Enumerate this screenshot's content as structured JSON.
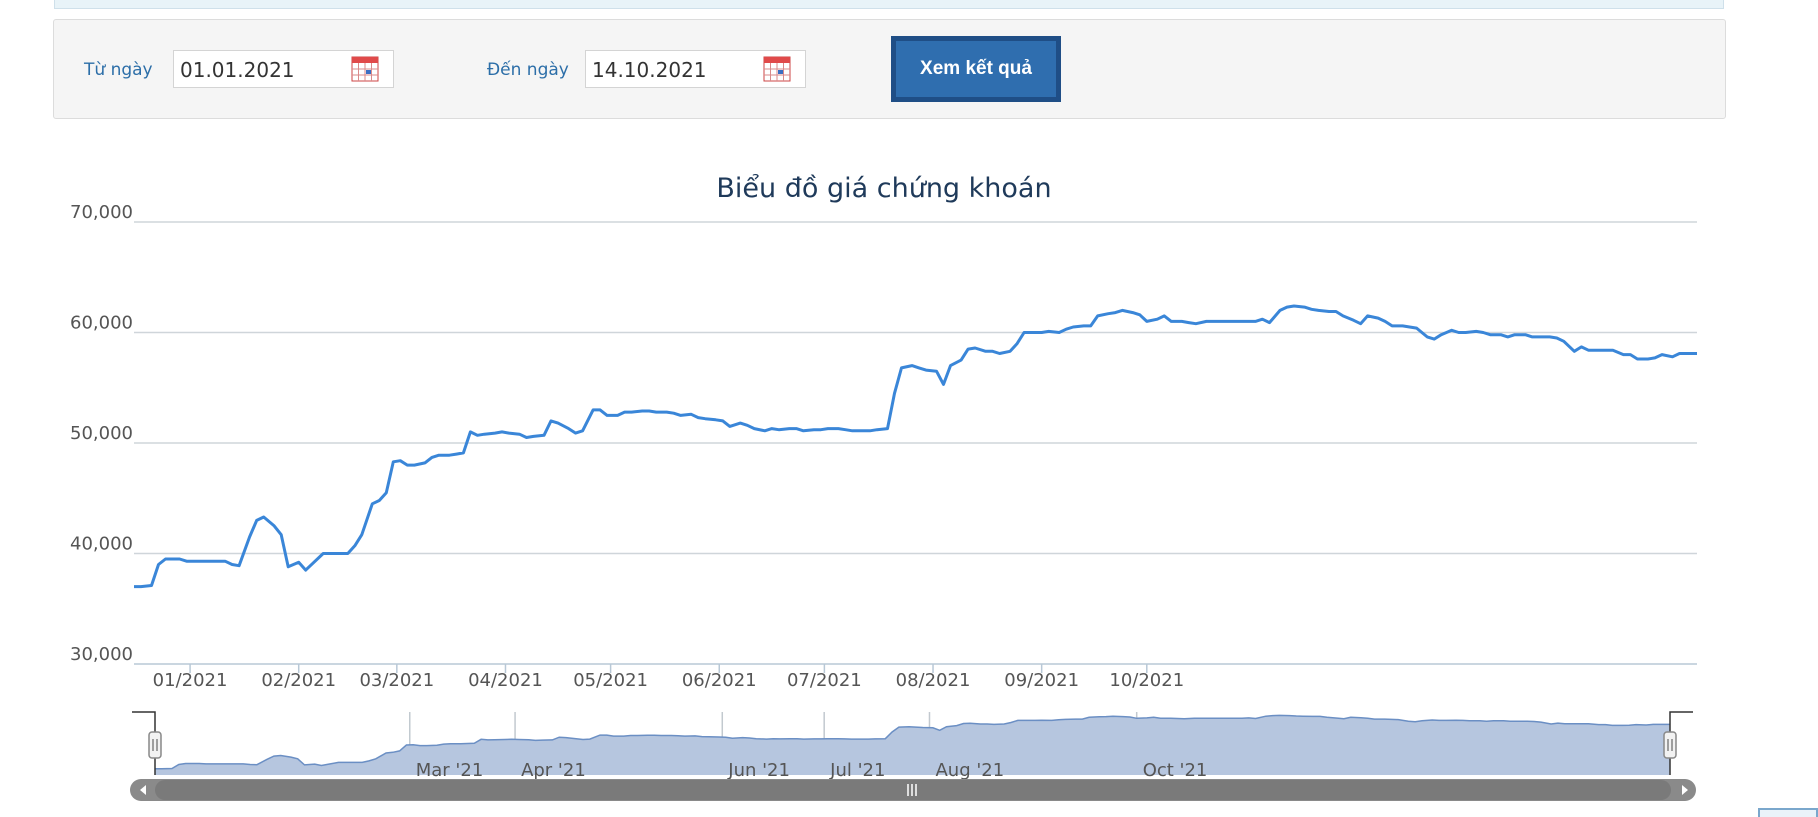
{
  "filter": {
    "from_label": "Từ ngày",
    "from_value": "01.01.2021",
    "to_label": "Đến ngày",
    "to_value": "14.10.2021",
    "submit_label": "Xem kết quả"
  },
  "colors": {
    "line": "#3a86d8",
    "navigator_fill": "#b6c6df",
    "navigator_line": "#6b8fc4",
    "grid": "#cfd5da",
    "button": "#2f6eaf"
  },
  "chart_data": {
    "type": "line",
    "title": "Biểu đồ giá chứng khoán",
    "xlabel": "",
    "ylabel": "",
    "ylim": [
      30000,
      70000
    ],
    "y_ticks": [
      "70,000",
      "60,000",
      "50,000",
      "40,000",
      "30,000"
    ],
    "y_tick_values": [
      70000,
      60000,
      50000,
      40000,
      30000
    ],
    "x_ticks": [
      {
        "label": "01/2021",
        "date": "2021-01-01"
      },
      {
        "label": "02/2021",
        "date": "2021-02-01"
      },
      {
        "label": "03/2021",
        "date": "2021-03-01"
      },
      {
        "label": "04/2021",
        "date": "2021-04-01"
      },
      {
        "label": "05/2021",
        "date": "2021-05-01"
      },
      {
        "label": "06/2021",
        "date": "2021-06-01"
      },
      {
        "label": "07/2021",
        "date": "2021-07-01"
      },
      {
        "label": "08/2021",
        "date": "2021-08-01"
      },
      {
        "label": "09/2021",
        "date": "2021-09-01"
      },
      {
        "label": "10/2021",
        "date": "2021-10-01"
      }
    ],
    "navigator_ticks": [
      {
        "label": "Mar '21",
        "date": "2021-03-01"
      },
      {
        "label": "Apr '21",
        "date": "2021-04-01"
      },
      {
        "label": "Jun '21",
        "date": "2021-06-01"
      },
      {
        "label": "Jul '21",
        "date": "2021-07-01"
      },
      {
        "label": "Aug '21",
        "date": "2021-08-01"
      },
      {
        "label": "Oct '21",
        "date": "2021-10-01"
      }
    ],
    "grid": true,
    "legend": "none",
    "series": [
      {
        "points": [
          [
            "2020-12-16",
            37000
          ],
          [
            "2020-12-18",
            37000
          ],
          [
            "2020-12-21",
            37100
          ],
          [
            "2020-12-23",
            39000
          ],
          [
            "2020-12-25",
            39500
          ],
          [
            "2020-12-29",
            39500
          ],
          [
            "2020-12-31",
            39300
          ],
          [
            "2021-01-04",
            39300
          ],
          [
            "2021-01-07",
            39300
          ],
          [
            "2021-01-11",
            39300
          ],
          [
            "2021-01-13",
            39000
          ],
          [
            "2021-01-15",
            38900
          ],
          [
            "2021-01-18",
            41500
          ],
          [
            "2021-01-20",
            43000
          ],
          [
            "2021-01-22",
            43300
          ],
          [
            "2021-01-25",
            42500
          ],
          [
            "2021-01-27",
            41700
          ],
          [
            "2021-01-29",
            38800
          ],
          [
            "2021-02-01",
            39200
          ],
          [
            "2021-02-03",
            38500
          ],
          [
            "2021-02-05",
            39100
          ],
          [
            "2021-02-08",
            40000
          ],
          [
            "2021-02-10",
            40000
          ],
          [
            "2021-02-15",
            40000
          ],
          [
            "2021-02-17",
            40700
          ],
          [
            "2021-02-19",
            41700
          ],
          [
            "2021-02-22",
            44500
          ],
          [
            "2021-02-24",
            44800
          ],
          [
            "2021-02-26",
            45500
          ],
          [
            "2021-02-28",
            48300
          ],
          [
            "2021-03-02",
            48400
          ],
          [
            "2021-03-04",
            48000
          ],
          [
            "2021-03-06",
            48000
          ],
          [
            "2021-03-09",
            48200
          ],
          [
            "2021-03-11",
            48700
          ],
          [
            "2021-03-13",
            48900
          ],
          [
            "2021-03-16",
            48900
          ],
          [
            "2021-03-18",
            49000
          ],
          [
            "2021-03-20",
            49100
          ],
          [
            "2021-03-22",
            51000
          ],
          [
            "2021-03-24",
            50700
          ],
          [
            "2021-03-26",
            50800
          ],
          [
            "2021-03-29",
            50900
          ],
          [
            "2021-03-31",
            51000
          ],
          [
            "2021-04-02",
            50900
          ],
          [
            "2021-04-05",
            50800
          ],
          [
            "2021-04-07",
            50500
          ],
          [
            "2021-04-09",
            50600
          ],
          [
            "2021-04-12",
            50700
          ],
          [
            "2021-04-14",
            52000
          ],
          [
            "2021-04-16",
            51800
          ],
          [
            "2021-04-19",
            51300
          ],
          [
            "2021-04-21",
            50900
          ],
          [
            "2021-04-23",
            51100
          ],
          [
            "2021-04-26",
            53000
          ],
          [
            "2021-04-28",
            53000
          ],
          [
            "2021-04-30",
            52500
          ],
          [
            "2021-05-03",
            52500
          ],
          [
            "2021-05-05",
            52800
          ],
          [
            "2021-05-07",
            52800
          ],
          [
            "2021-05-10",
            52900
          ],
          [
            "2021-05-12",
            52900
          ],
          [
            "2021-05-14",
            52800
          ],
          [
            "2021-05-17",
            52800
          ],
          [
            "2021-05-19",
            52700
          ],
          [
            "2021-05-21",
            52500
          ],
          [
            "2021-05-24",
            52600
          ],
          [
            "2021-05-26",
            52300
          ],
          [
            "2021-05-28",
            52200
          ],
          [
            "2021-05-31",
            52100
          ],
          [
            "2021-06-02",
            52000
          ],
          [
            "2021-06-04",
            51500
          ],
          [
            "2021-06-07",
            51800
          ],
          [
            "2021-06-09",
            51600
          ],
          [
            "2021-06-11",
            51300
          ],
          [
            "2021-06-14",
            51100
          ],
          [
            "2021-06-16",
            51300
          ],
          [
            "2021-06-18",
            51200
          ],
          [
            "2021-06-21",
            51300
          ],
          [
            "2021-06-23",
            51300
          ],
          [
            "2021-06-25",
            51100
          ],
          [
            "2021-06-28",
            51200
          ],
          [
            "2021-06-30",
            51200
          ],
          [
            "2021-07-02",
            51300
          ],
          [
            "2021-07-05",
            51300
          ],
          [
            "2021-07-07",
            51200
          ],
          [
            "2021-07-09",
            51100
          ],
          [
            "2021-07-12",
            51100
          ],
          [
            "2021-07-14",
            51100
          ],
          [
            "2021-07-16",
            51200
          ],
          [
            "2021-07-19",
            51300
          ],
          [
            "2021-07-21",
            54500
          ],
          [
            "2021-07-23",
            56800
          ],
          [
            "2021-07-26",
            57000
          ],
          [
            "2021-07-28",
            56800
          ],
          [
            "2021-07-30",
            56600
          ],
          [
            "2021-08-02",
            56500
          ],
          [
            "2021-08-04",
            55300
          ],
          [
            "2021-08-06",
            57000
          ],
          [
            "2021-08-09",
            57500
          ],
          [
            "2021-08-11",
            58500
          ],
          [
            "2021-08-13",
            58600
          ],
          [
            "2021-08-16",
            58300
          ],
          [
            "2021-08-18",
            58300
          ],
          [
            "2021-08-20",
            58100
          ],
          [
            "2021-08-23",
            58300
          ],
          [
            "2021-08-25",
            59000
          ],
          [
            "2021-08-27",
            60000
          ],
          [
            "2021-08-30",
            60000
          ],
          [
            "2021-09-01",
            60000
          ],
          [
            "2021-09-03",
            60100
          ],
          [
            "2021-09-06",
            60000
          ],
          [
            "2021-09-08",
            60300
          ],
          [
            "2021-09-10",
            60500
          ],
          [
            "2021-09-13",
            60600
          ],
          [
            "2021-09-15",
            60600
          ],
          [
            "2021-09-17",
            61500
          ],
          [
            "2021-09-20",
            61700
          ],
          [
            "2021-09-22",
            61800
          ],
          [
            "2021-09-24",
            62000
          ],
          [
            "2021-09-27",
            61800
          ],
          [
            "2021-09-29",
            61600
          ],
          [
            "2021-10-01",
            61000
          ],
          [
            "2021-10-04",
            61200
          ],
          [
            "2021-10-06",
            61500
          ],
          [
            "2021-10-08",
            61000
          ],
          [
            "2021-10-11",
            61000
          ],
          [
            "2021-10-13",
            60900
          ],
          [
            "2021-10-15",
            60800
          ],
          [
            "2021-10-18",
            61000
          ],
          [
            "2021-10-20",
            61000
          ],
          [
            "2021-10-22",
            61000
          ],
          [
            "2021-10-25",
            61000
          ],
          [
            "2021-10-27",
            61000
          ],
          [
            "2021-10-29",
            61000
          ],
          [
            "2021-11-01",
            61000
          ],
          [
            "2021-11-03",
            61200
          ],
          [
            "2021-11-05",
            60900
          ],
          [
            "2021-11-08",
            62000
          ],
          [
            "2021-11-10",
            62300
          ],
          [
            "2021-11-12",
            62400
          ],
          [
            "2021-11-15",
            62300
          ],
          [
            "2021-11-17",
            62100
          ],
          [
            "2021-11-19",
            62000
          ],
          [
            "2021-11-22",
            61900
          ],
          [
            "2021-11-24",
            61900
          ],
          [
            "2021-11-26",
            61500
          ],
          [
            "2021-11-29",
            61100
          ],
          [
            "2021-12-01",
            60800
          ],
          [
            "2021-12-03",
            61500
          ],
          [
            "2021-12-06",
            61300
          ],
          [
            "2021-12-08",
            61000
          ],
          [
            "2021-12-10",
            60600
          ],
          [
            "2021-12-13",
            60600
          ],
          [
            "2021-12-15",
            60500
          ],
          [
            "2021-12-17",
            60400
          ],
          [
            "2021-12-20",
            59600
          ],
          [
            "2021-12-22",
            59400
          ],
          [
            "2021-12-24",
            59800
          ],
          [
            "2021-12-27",
            60200
          ],
          [
            "2021-12-29",
            60000
          ],
          [
            "2021-12-31",
            60000
          ],
          [
            "2022-01-03",
            60100
          ],
          [
            "2022-01-05",
            60000
          ],
          [
            "2022-01-07",
            59800
          ],
          [
            "2022-01-10",
            59800
          ],
          [
            "2022-01-12",
            59600
          ],
          [
            "2022-01-14",
            59800
          ],
          [
            "2022-01-17",
            59800
          ],
          [
            "2022-01-19",
            59600
          ],
          [
            "2022-01-21",
            59600
          ],
          [
            "2022-01-24",
            59600
          ],
          [
            "2022-01-26",
            59500
          ],
          [
            "2022-01-28",
            59200
          ],
          [
            "2022-01-31",
            58300
          ],
          [
            "2022-02-02",
            58700
          ],
          [
            "2022-02-04",
            58400
          ],
          [
            "2022-02-07",
            58400
          ],
          [
            "2022-02-09",
            58400
          ],
          [
            "2022-02-11",
            58400
          ],
          [
            "2022-02-14",
            58000
          ],
          [
            "2022-02-16",
            58000
          ],
          [
            "2022-02-18",
            57600
          ],
          [
            "2022-02-21",
            57600
          ],
          [
            "2022-02-23",
            57700
          ],
          [
            "2022-02-25",
            58000
          ],
          [
            "2022-02-28",
            57800
          ],
          [
            "2022-03-02",
            58100
          ],
          [
            "2022-03-04",
            58100
          ],
          [
            "2022-03-07",
            58100
          ]
        ]
      }
    ]
  }
}
